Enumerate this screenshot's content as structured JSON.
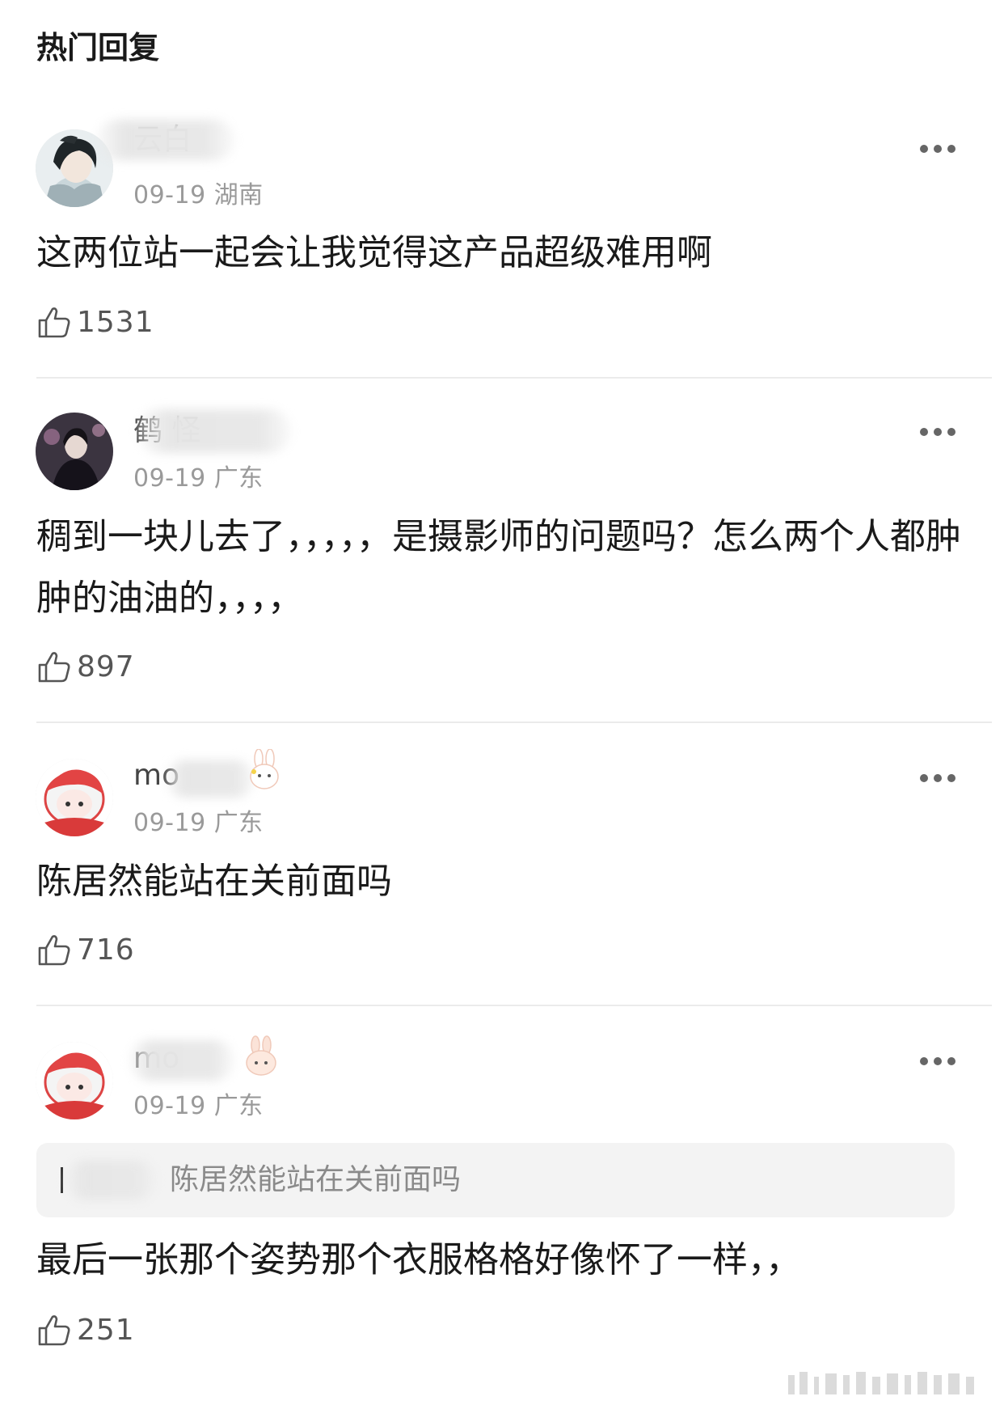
{
  "header": {
    "title": "热门回复"
  },
  "comments": [
    {
      "username": "云白",
      "date": "09-19",
      "region": "湖南",
      "text": "这两位站一起会让我觉得这产品超级难用啊",
      "likes": "1531"
    },
    {
      "username": "鹤         怪",
      "date": "09-19",
      "region": "广东",
      "text": "稠到一块儿去了，，，，，是摄影师的问题吗？怎么两个人都肿肿的油油的，，，，",
      "likes": "897"
    },
    {
      "username": "mo",
      "date": "09-19",
      "region": "广东",
      "text": "陈居然能站在关前面吗",
      "likes": "716"
    },
    {
      "username": "mo",
      "date": "09-19",
      "region": "广东",
      "quote": "陈居然能站在关前面吗",
      "text": "最后一张那个姿势那个衣服格格好像怀了一样，，",
      "likes": "251"
    }
  ],
  "icons": {
    "like": "thumbs-up-icon",
    "more": "more-dots-icon"
  },
  "colors": {
    "meta_text": "#9a9a9a",
    "body_text": "#1a1a1a",
    "divider": "#ebebeb",
    "quote_bg": "#f3f3f3"
  }
}
